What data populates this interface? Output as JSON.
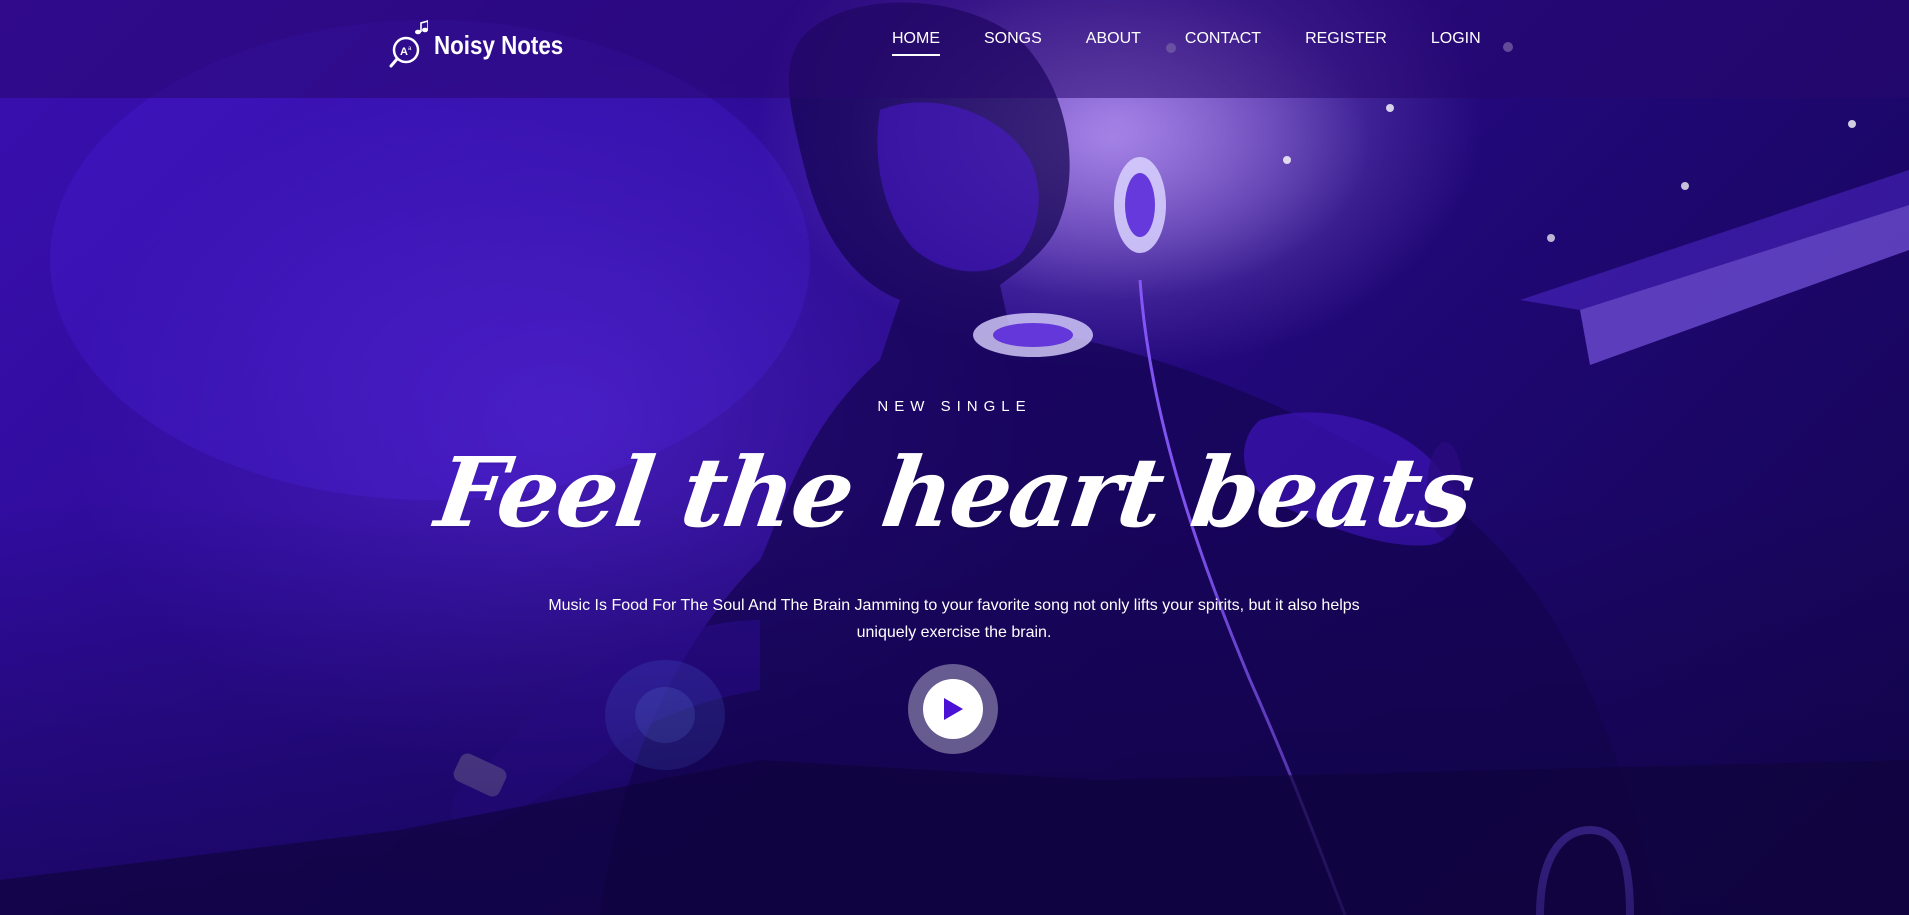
{
  "brand": {
    "name": "Noisy Notes",
    "logo_icon": "music-note-magnifier-icon"
  },
  "nav": {
    "items": [
      {
        "label": "HOME",
        "active": true
      },
      {
        "label": "SONGS",
        "active": false
      },
      {
        "label": "ABOUT",
        "active": false
      },
      {
        "label": "CONTACT",
        "active": false
      },
      {
        "label": "REGISTER",
        "active": false
      },
      {
        "label": "LOGIN",
        "active": false
      }
    ]
  },
  "hero": {
    "kicker": "NEW SINGLE",
    "headline": "Feel the heart beats",
    "subtitle": "Music Is Food For The Soul And The Brain Jamming to your favorite song not only lifts your spirits, but it also helps uniquely exercise the brain.",
    "play_icon": "play-icon"
  },
  "colors": {
    "accent": "#4b12d6",
    "hero_tint": "#2b0b93",
    "text": "#ffffff"
  }
}
